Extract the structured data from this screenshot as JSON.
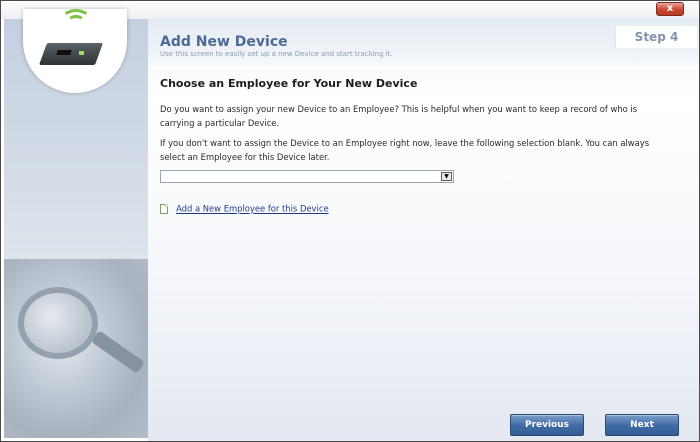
{
  "window": {
    "close_label": "x"
  },
  "header": {
    "title": "Add New Device",
    "subtitle": "Use this screen to easily set up a new Device and start tracking it.",
    "step": "Step 4"
  },
  "content": {
    "heading": "Choose an Employee for Your New Device",
    "paragraph1": "Do you want to assign your new Device to an Employee? This is helpful when you want to keep a record of who is carrying a particular Device.",
    "paragraph2": "If you don't want to assign the Device to an Employee right now, leave the following selection blank. You can always select an Employee for this Device later.",
    "employee_select": {
      "value": ""
    },
    "add_employee_link": "Add a New Employee for this Device"
  },
  "footer": {
    "previous_label": "Previous",
    "next_label": "Next"
  },
  "icons": {
    "device": "gps-device-icon",
    "wireless": "wifi-signal-icon",
    "new_document": "new-document-icon",
    "dropdown": "chevron-down-icon"
  },
  "colors": {
    "title": "#4b6a95",
    "button": "#3e6aa3",
    "link": "#1f3c86",
    "close": "#c9472f"
  }
}
